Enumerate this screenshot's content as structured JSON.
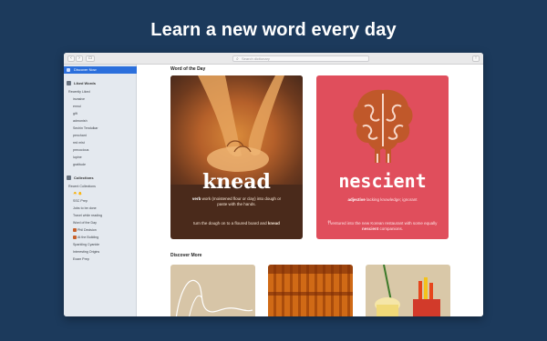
{
  "headline": "Learn a new word every day",
  "toolbar": {
    "search_placeholder": "Search dictionary"
  },
  "sidebar": {
    "selected": "Discover Now",
    "liked_header": "Liked Words",
    "liked_items": [
      "Recently Liked",
      "invasive",
      "ennui",
      "gift",
      "admonish",
      "Sechin Tendulkar",
      "penchant",
      "red mist",
      "precocious",
      "lupine",
      "gratitude"
    ],
    "collections_header": "Collections",
    "collection_items": [
      "Recent Collections",
      "🐣 🐥",
      "SSC Prep",
      "Jobs to be done",
      "Travel while reading",
      "Word of the Day",
      "Phil Decision",
      "At the Building",
      "Sparkling Cyanide",
      "Interesting Origins",
      "Exam Prep"
    ]
  },
  "main": {
    "wotd_title": "Word of the Day",
    "card1": {
      "word": "knead",
      "pos": "verb",
      "definition": "work (moistened flour or clay) into dough or paste with the hands.",
      "example_pre": "turn the dough on to a floured board and",
      "example_word": "knead"
    },
    "card2": {
      "word": "nescient",
      "pos": "adjective",
      "definition": "lacking knowledge; ignorant",
      "example_pre": "I ventured into the new Korean restaurant with some equally",
      "example_word": "nescient",
      "example_post": "companions."
    },
    "discover_title": "Discover More"
  },
  "colors": {
    "background": "#1c3a5c",
    "accent": "#2b6fdc",
    "knead_card": "#4a2a1b",
    "nescient_card": "#e04e5c"
  }
}
